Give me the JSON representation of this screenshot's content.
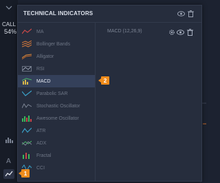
{
  "sidebar": {
    "call_label": "CALL",
    "call_percent": "54%"
  },
  "panel": {
    "title": "TECHNICAL INDICATORS",
    "indicators": [
      {
        "label": "MA",
        "icon": "ma-icon"
      },
      {
        "label": "Bollinger Bands",
        "icon": "bollinger-bands-icon"
      },
      {
        "label": "Alligator",
        "icon": "alligator-icon"
      },
      {
        "label": "RSI",
        "icon": "rsi-icon"
      },
      {
        "label": "MACD",
        "icon": "macd-icon",
        "selected": true
      },
      {
        "label": "Parabolic SAR",
        "icon": "parabolic-sar-icon"
      },
      {
        "label": "Stochastic Oscillator",
        "icon": "stochastic-oscillator-icon"
      },
      {
        "label": "Awesome Oscillator",
        "icon": "awesome-oscillator-icon"
      },
      {
        "label": "ATR",
        "icon": "atr-icon"
      },
      {
        "label": "ADX",
        "icon": "adx-icon"
      },
      {
        "label": "Fractal",
        "icon": "fractal-icon"
      },
      {
        "label": "CCI",
        "icon": "cci-icon"
      }
    ],
    "active_indicator": "MACD (12,26,9)"
  },
  "callouts": {
    "first": "1",
    "second": "2"
  },
  "colors": {
    "accent_orange": "#f08c1c",
    "panel_bg": "#262d3d",
    "selected_bg": "#34405a"
  }
}
